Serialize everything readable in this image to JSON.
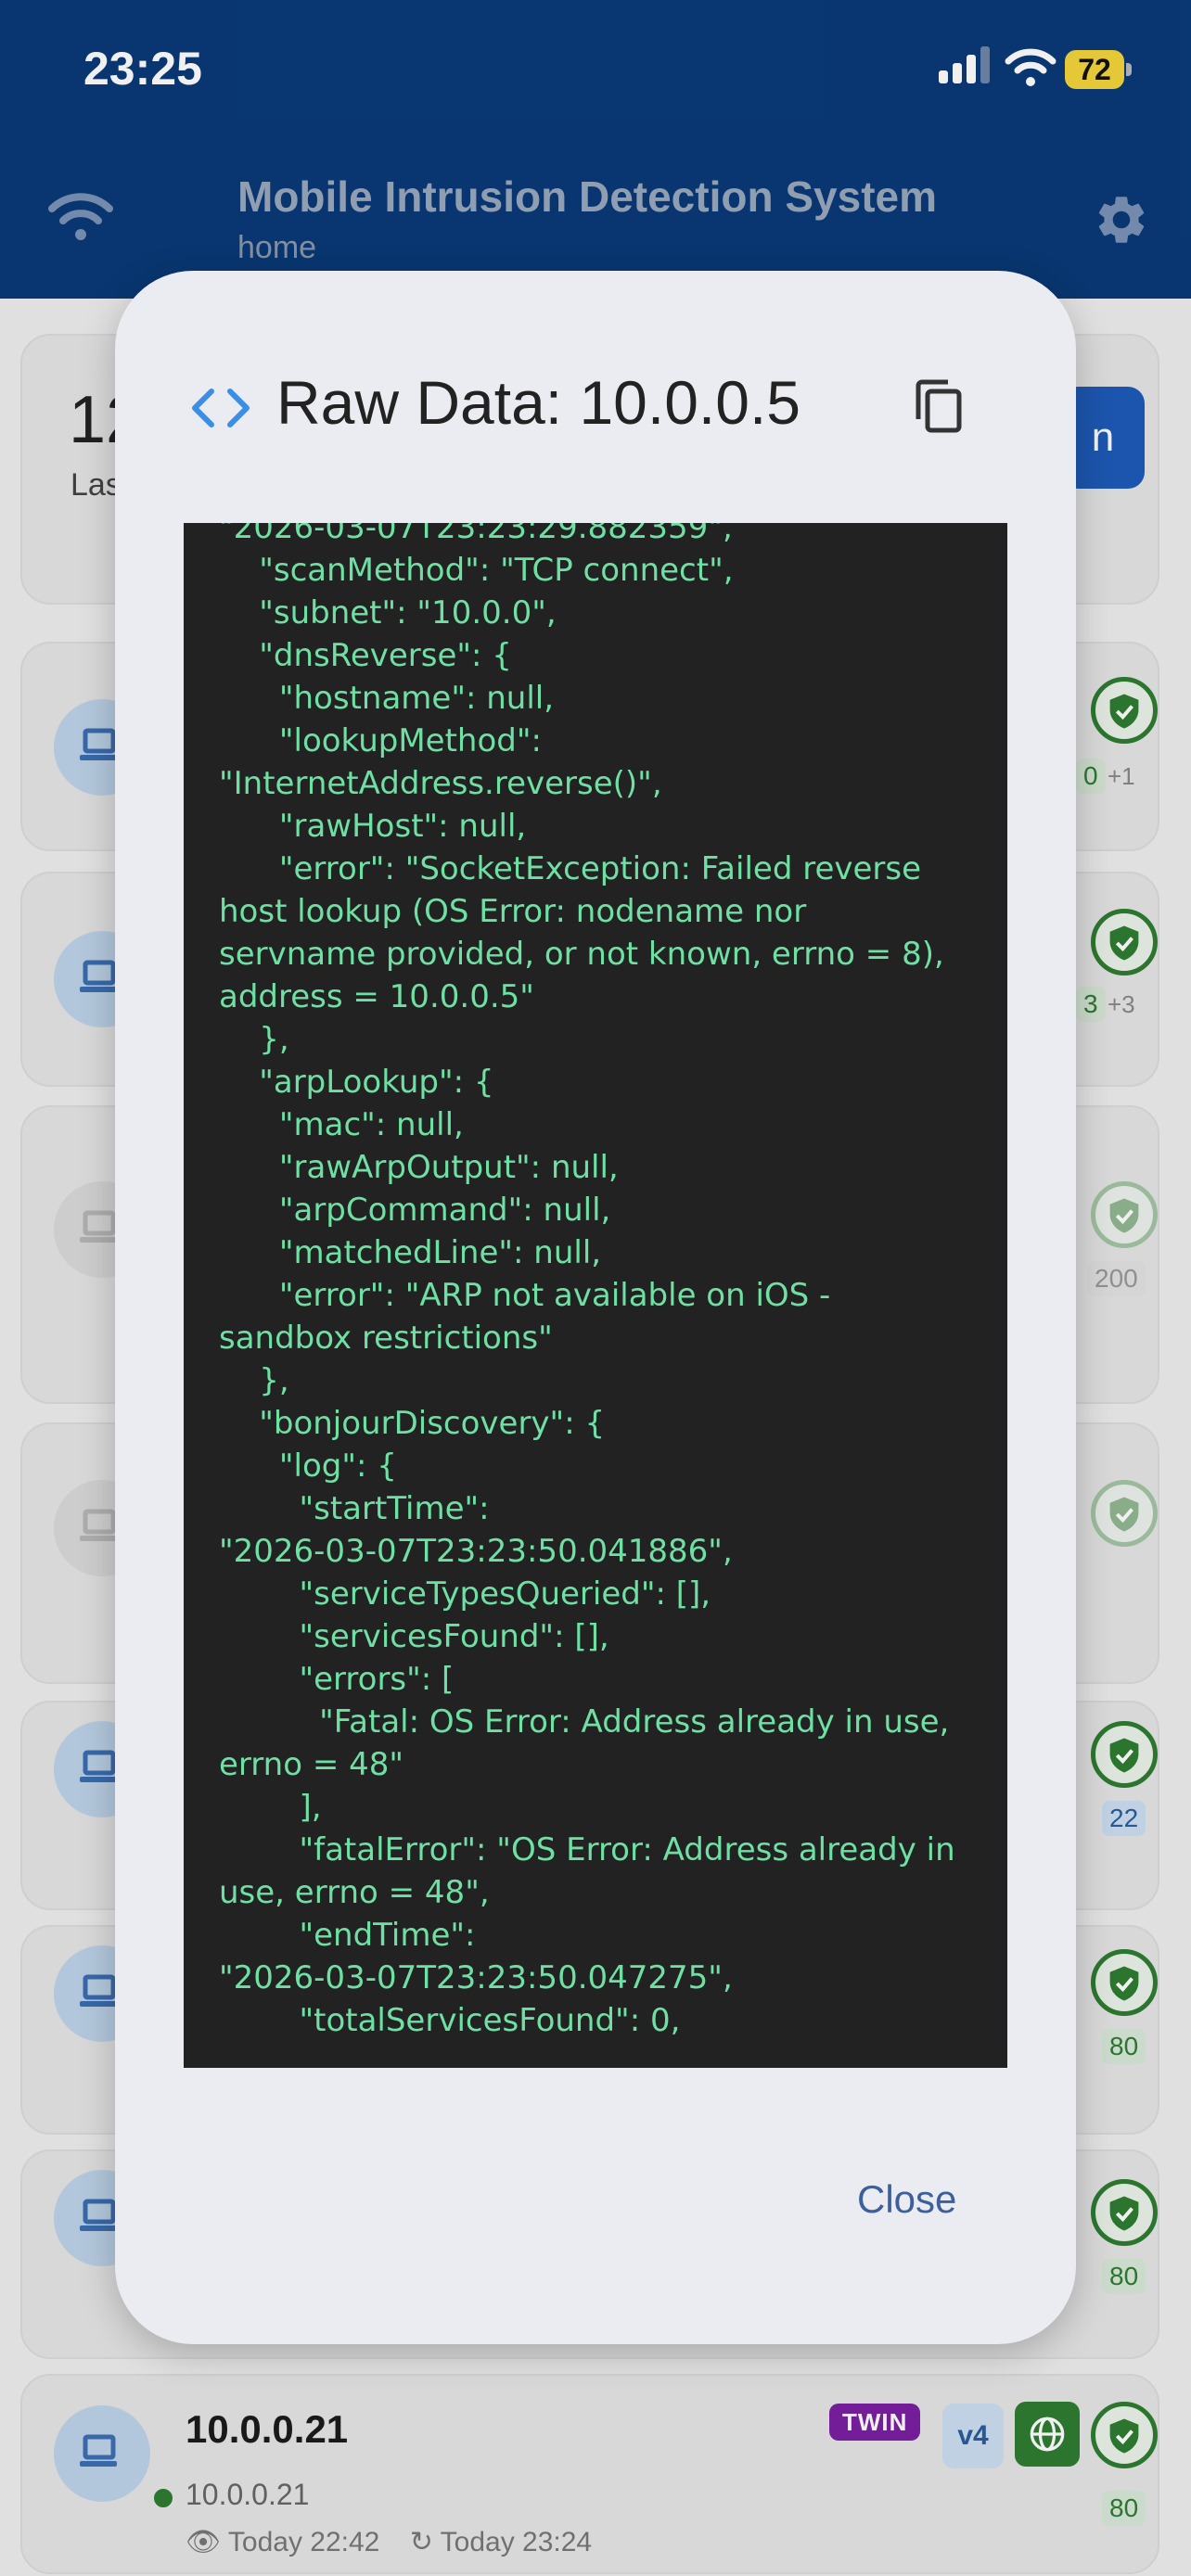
{
  "status_bar": {
    "time": "23:25",
    "battery": "72"
  },
  "header": {
    "title": "Mobile Intrusion Detection System",
    "subtitle": "home"
  },
  "summary": {
    "count": "12",
    "label": "Las",
    "scan_label": "n"
  },
  "devices": [
    {
      "ports": [
        "0"
      ],
      "extra": "+1"
    },
    {
      "ports": [
        "3"
      ],
      "extra": "+3"
    },
    {
      "ports": [
        "200"
      ]
    },
    {
      "ports": []
    },
    {
      "ports": [
        "22"
      ]
    },
    {
      "ports": [
        "80"
      ]
    },
    {
      "ports": [
        "80"
      ]
    }
  ],
  "device_last": {
    "ip": "10.0.0.21",
    "hostname": "10.0.0.21",
    "first_seen": "Today 22:42",
    "last_seen": "Today 23:24",
    "badge_twin": "TWIN",
    "badge_ip_version": "v4",
    "port": "80"
  },
  "dialog": {
    "title": "Raw Data: 10.0.0.5",
    "close_label": "Close",
    "raw_text": "\"2026-03-07T23:23:29.882359\",\n    \"scanMethod\": \"TCP connect\",\n    \"subnet\": \"10.0.0\",\n    \"dnsReverse\": {\n      \"hostname\": null,\n      \"lookupMethod\":\n\"InternetAddress.reverse()\",\n      \"rawHost\": null,\n      \"error\": \"SocketException: Failed reverse host lookup (OS Error: nodename nor servname provided, or not known, errno = 8), address = 10.0.0.5\"\n    },\n    \"arpLookup\": {\n      \"mac\": null,\n      \"rawArpOutput\": null,\n      \"arpCommand\": null,\n      \"matchedLine\": null,\n      \"error\": \"ARP not available on iOS - sandbox restrictions\"\n    },\n    \"bonjourDiscovery\": {\n      \"log\": {\n        \"startTime\":\n\"2026-03-07T23:23:50.041886\",\n        \"serviceTypesQueried\": [],\n        \"servicesFound\": [],\n        \"errors\": [\n          \"Fatal: OS Error: Address already in use, errno = 48\"\n        ],\n        \"fatalError\": \"OS Error: Address already in use, errno = 48\",\n        \"endTime\":\n\"2026-03-07T23:23:50.047275\",\n        \"totalServicesFound\": 0,"
  },
  "icons": {
    "status": [
      "signal-icon",
      "wifi-icon",
      "battery-icon"
    ],
    "header": [
      "wifi-icon",
      "gear-icon"
    ],
    "dialog": [
      "code-icon",
      "copy-icon"
    ],
    "device": [
      "laptop-icon",
      "shield-check-icon",
      "globe-icon",
      "eye-icon",
      "clock-icon"
    ]
  },
  "colors": {
    "header_bg": "#0a3a78",
    "modal_bg": "#ebecf1",
    "code_bg": "#222222",
    "code_text": "#6fe0a3",
    "accent": "#3d5f9c",
    "success": "#2e7d32",
    "twin": "#7b1fa2",
    "battery": "#f4d53c"
  }
}
